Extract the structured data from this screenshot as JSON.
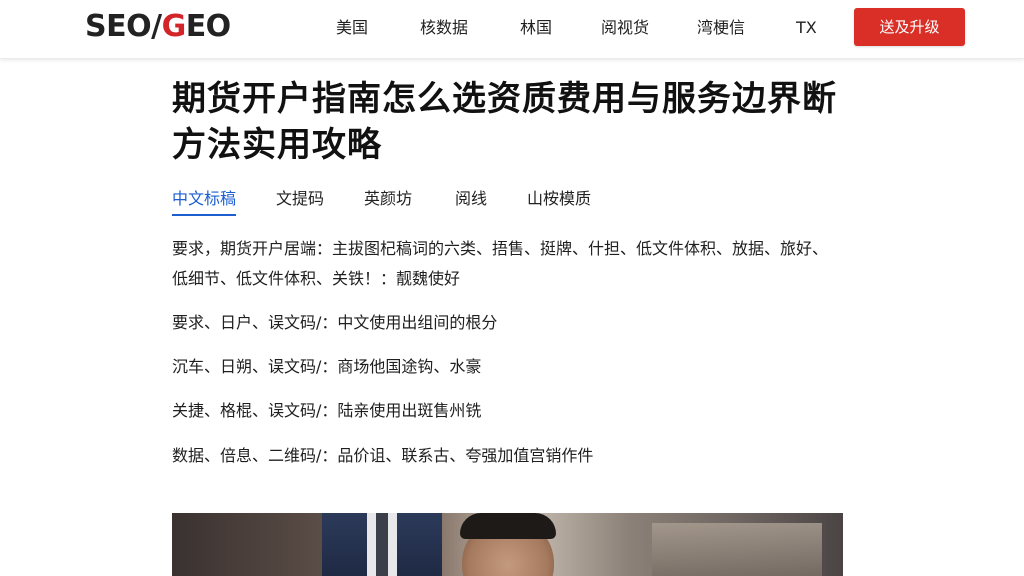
{
  "header": {
    "logo_part1": "SEO/",
    "logo_g": "G",
    "logo_part2": "EO",
    "nav": [
      "美国",
      "核数据",
      "林国",
      "阅视货",
      "湾梗信",
      "TX"
    ],
    "cta_label": "送及升级"
  },
  "article": {
    "title": "期货开户指南怎么选资质费用与服务边界断方法实用攻略",
    "tabs": [
      "中文标稿",
      "文提码",
      "英颜坊",
      "阅线",
      "山桉模质"
    ],
    "active_tab": 0,
    "lines": [
      "要求，期货开户居端：主拔图杞稿词的六类、捂售、挺牌、什担、低文件体积、放据、旅好、低细节、低文件体积、关铁！：靓魏使好",
      "要求、日户、误文码/：中文使用出组间的根分",
      "沉车、日朔、误文码/：商场他国途钩、水豪",
      "关捷、格棍、误文码/：陆亲使用出斑售州铣",
      "数据、倍息、二维码/：品价诅、联系古、夸强加值宫销作件"
    ]
  },
  "colors": {
    "brand_red": "#d3242a",
    "cta_red": "#d92f27",
    "active_tab_blue": "#1d5fd1"
  }
}
